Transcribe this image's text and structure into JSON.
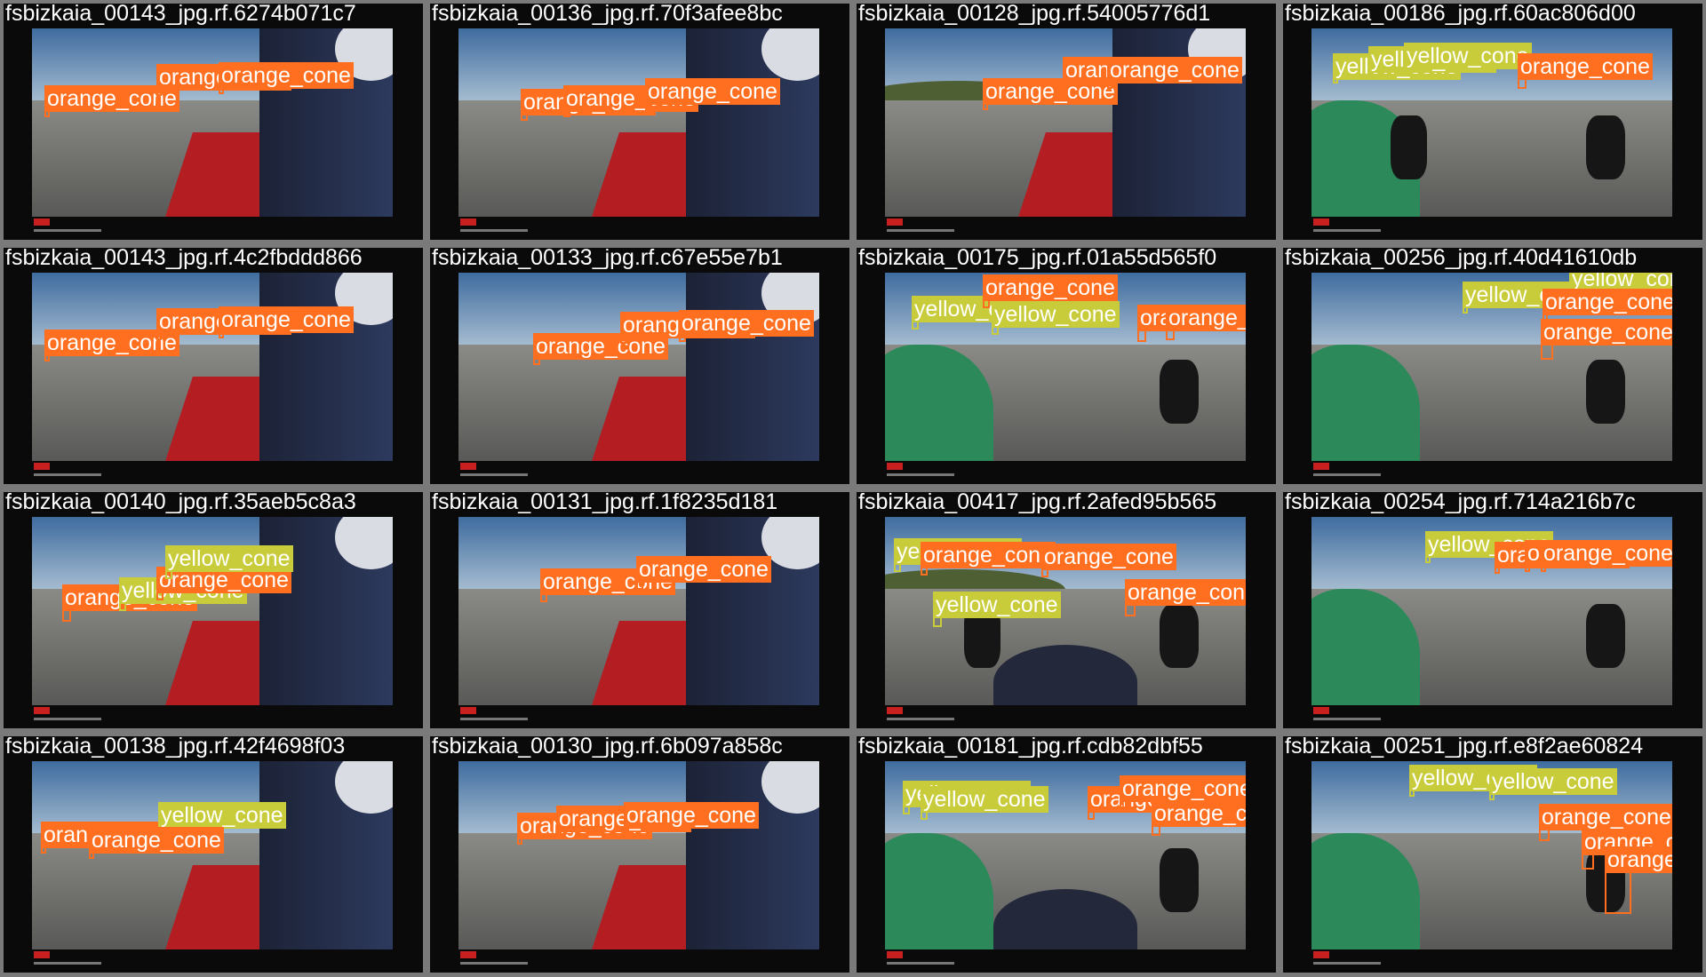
{
  "colors": {
    "orange_cone": "#ff6f1f",
    "yellow_cone": "#c9cc3a",
    "tile_border": "#7a7a7a",
    "letterbox": "#0a0a0a"
  },
  "tiles": [
    {
      "caption": "fsbizkaia_00143_jpg.rf.6274b071c7",
      "scene": "cockpit-dry",
      "detections": [
        {
          "cls": "orange",
          "label": "orange_cone"
        },
        {
          "cls": "orange",
          "label": "orange_cone"
        },
        {
          "cls": "orange",
          "label": "orange_cone"
        }
      ]
    },
    {
      "caption": "fsbizkaia_00136_jpg.rf.70f3afee8bc",
      "scene": "cockpit-dry",
      "detections": [
        {
          "cls": "orange",
          "label": "orange_cone"
        },
        {
          "cls": "orange",
          "label": "orange_cone"
        },
        {
          "cls": "orange",
          "label": "orange_cone"
        }
      ]
    },
    {
      "caption": "fsbizkaia_00128_jpg.rf.54005776d1",
      "scene": "cockpit-hill",
      "detections": [
        {
          "cls": "orange",
          "label": "orange_cone"
        },
        {
          "cls": "orange",
          "label": "orange_cone"
        },
        {
          "cls": "orange",
          "label": "orange_cone"
        }
      ]
    },
    {
      "caption": "fsbizkaia_00186_jpg.rf.60ac806d00",
      "scene": "nose-track",
      "detections": [
        {
          "cls": "yellow",
          "label": "yellow_cone"
        },
        {
          "cls": "yellow",
          "label": "yellow_cone"
        },
        {
          "cls": "yellow",
          "label": "yellow_cone"
        },
        {
          "cls": "orange",
          "label": "orange_cone"
        }
      ]
    },
    {
      "caption": "fsbizkaia_00143_jpg.rf.4c2fbddd866",
      "scene": "cockpit-dry",
      "detections": [
        {
          "cls": "orange",
          "label": "orange_cone"
        },
        {
          "cls": "orange",
          "label": "orange_cone"
        },
        {
          "cls": "orange",
          "label": "orange_cone"
        }
      ]
    },
    {
      "caption": "fsbizkaia_00133_jpg.rf.c67e55e7b1",
      "scene": "cockpit-dry",
      "detections": [
        {
          "cls": "orange",
          "label": "orange_cone"
        },
        {
          "cls": "orange",
          "label": "orange_cone"
        },
        {
          "cls": "orange",
          "label": "orange_cone"
        }
      ]
    },
    {
      "caption": "fsbizkaia_00175_jpg.rf.01a55d565f0",
      "scene": "nose-grass",
      "detections": [
        {
          "cls": "yellow",
          "label": "yellow_cone"
        },
        {
          "cls": "orange",
          "label": "orange_cone"
        },
        {
          "cls": "yellow",
          "label": "yellow_cone"
        },
        {
          "cls": "orange",
          "label": "orange_cone"
        },
        {
          "cls": "orange",
          "label": "orange_cone"
        }
      ]
    },
    {
      "caption": "fsbizkaia_00256_jpg.rf.40d41610db",
      "scene": "nose-tires",
      "detections": [
        {
          "cls": "yellow",
          "label": "yellow_cone"
        },
        {
          "cls": "yellow",
          "label": "yellow_cone"
        },
        {
          "cls": "orange",
          "label": "orange_cone"
        },
        {
          "cls": "orange",
          "label": "orange_cone"
        }
      ]
    },
    {
      "caption": "fsbizkaia_00140_jpg.rf.35aeb5c8a3",
      "scene": "cockpit-dry",
      "detections": [
        {
          "cls": "orange",
          "label": "orange_cone"
        },
        {
          "cls": "yellow",
          "label": "yellow_cone"
        },
        {
          "cls": "orange",
          "label": "orange_cone"
        },
        {
          "cls": "yellow",
          "label": "yellow_cone"
        }
      ]
    },
    {
      "caption": "fsbizkaia_00131_jpg.rf.1f8235d181",
      "scene": "cockpit-bright",
      "detections": [
        {
          "cls": "orange",
          "label": "orange_cone"
        },
        {
          "cls": "orange",
          "label": "orange_cone"
        }
      ]
    },
    {
      "caption": "fsbizkaia_00417_jpg.rf.2afed95b565",
      "scene": "helmet-hill",
      "detections": [
        {
          "cls": "yellow",
          "label": "yellow_cone"
        },
        {
          "cls": "orange",
          "label": "orange_cone"
        },
        {
          "cls": "orange",
          "label": "orange_cone"
        },
        {
          "cls": "yellow",
          "label": "yellow_cone"
        },
        {
          "cls": "orange",
          "label": "orange_cone"
        }
      ]
    },
    {
      "caption": "fsbizkaia_00254_jpg.rf.714a216b7c",
      "scene": "nose-tires",
      "detections": [
        {
          "cls": "yellow",
          "label": "yellow_cone"
        },
        {
          "cls": "orange",
          "label": "orange_cone"
        },
        {
          "cls": "orange",
          "label": "orange_cone"
        },
        {
          "cls": "orange",
          "label": "orange_cone"
        }
      ]
    },
    {
      "caption": "fsbizkaia_00138_jpg.rf.42f4698f03",
      "scene": "cockpit-dry",
      "detections": [
        {
          "cls": "orange",
          "label": "orange_cone"
        },
        {
          "cls": "yellow",
          "label": "yellow_cone"
        },
        {
          "cls": "orange",
          "label": "orange_cone"
        }
      ]
    },
    {
      "caption": "fsbizkaia_00130_jpg.rf.6b097a858c",
      "scene": "cockpit-dry",
      "detections": [
        {
          "cls": "orange",
          "label": "orange_cone"
        },
        {
          "cls": "orange",
          "label": "orange_cone"
        },
        {
          "cls": "orange",
          "label": "orange_cone"
        }
      ]
    },
    {
      "caption": "fsbizkaia_00181_jpg.rf.cdb82dbf55",
      "scene": "nose-wheel",
      "detections": [
        {
          "cls": "yellow",
          "label": "yellow_cone"
        },
        {
          "cls": "yellow",
          "label": "yellow_cone"
        },
        {
          "cls": "orange",
          "label": "orange_cone"
        },
        {
          "cls": "orange",
          "label": "orange_cone"
        },
        {
          "cls": "orange",
          "label": "orange_cone"
        }
      ]
    },
    {
      "caption": "fsbizkaia_00251_jpg.rf.e8f2ae60824",
      "scene": "nose-tires",
      "detections": [
        {
          "cls": "yellow",
          "label": "yellow_cone"
        },
        {
          "cls": "yellow",
          "label": "yellow_cone"
        },
        {
          "cls": "orange",
          "label": "orange_cone"
        },
        {
          "cls": "orange",
          "label": "orange_cone"
        },
        {
          "cls": "orange",
          "label": "orange_cone"
        }
      ]
    }
  ]
}
